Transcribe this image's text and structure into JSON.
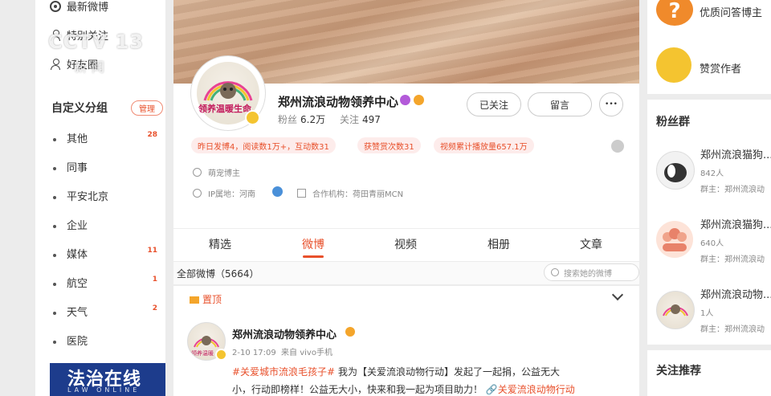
{
  "left_nav": {
    "items": [
      {
        "label": "最新微博"
      },
      {
        "label": "特别关注"
      },
      {
        "label": "好友圈"
      }
    ],
    "custom_group": {
      "title": "自定义分组",
      "manage_label": "管理"
    },
    "groups": [
      {
        "label": "其他",
        "count": "28"
      },
      {
        "label": "同事",
        "count": ""
      },
      {
        "label": "平安北京",
        "count": ""
      },
      {
        "label": "企业",
        "count": ""
      },
      {
        "label": "媒体",
        "count": "11"
      },
      {
        "label": "航空",
        "count": "1"
      },
      {
        "label": "天气",
        "count": "2"
      },
      {
        "label": "医院",
        "count": ""
      }
    ]
  },
  "watermark": {
    "tv_logo": "法治在线",
    "tv_logo_sub": "LAW ONLINE",
    "cctv": "CCTV 13",
    "cctv_sub": "新闻"
  },
  "profile": {
    "avatar_text": "领养温暖生命",
    "name": "郑州流浪动物领养中心",
    "fans_label": "粉丝",
    "fans_value": "6.2万",
    "follow_label": "关注",
    "follow_value": "497",
    "followed_button": "已关注",
    "message_button": "留言",
    "more_button": "•••",
    "pills": [
      "昨日发博4，阅读数1万+，互动数31",
      "获赞赏次数31",
      "视频累计播放量657.1万"
    ],
    "tag": "萌宠博主",
    "ip_location": "IP属地：河南",
    "agency": "合作机构：荷田青丽MCN"
  },
  "tabs": {
    "items": [
      {
        "label": "精选"
      },
      {
        "label": "微博"
      },
      {
        "label": "视频"
      },
      {
        "label": "相册"
      },
      {
        "label": "文章"
      }
    ],
    "active_index": 1
  },
  "feed": {
    "all_label": "全部微博（5664）",
    "search_placeholder": "搜索她的微博",
    "pinned_label": "置顶",
    "post": {
      "author": "郑州流浪动物领养中心",
      "time_source": "2-10 17:09  来自 vivo手机",
      "text_line1_tag": "#关爱城市流浪毛孩子#",
      "text_line1_rest": " 我为【关爱流浪动物行动】发起了一起捐，公益无大",
      "text_line2": "小，行动即榜样！公益无大小，快来和我一起为项目助力！",
      "text_line2_link": "关爱流浪动物行动"
    }
  },
  "right": {
    "top_items": [
      {
        "label": "优质问答博主"
      },
      {
        "label": "赞赏作者"
      }
    ],
    "fan_group_title": "粉丝群",
    "fan_groups": [
      {
        "name": "郑州流浪猫狗...",
        "count": "842人",
        "owner": "群主：郑州流浪动"
      },
      {
        "name": "郑州流浪猫狗...",
        "count": "640人",
        "owner": "群主：郑州流浪动"
      },
      {
        "name": "郑州流浪动物...",
        "count": "1人",
        "owner": "群主：郑州流浪动"
      }
    ],
    "recommend_title": "关注推荐"
  },
  "colors": {
    "accent": "#e8502b",
    "pill_bg": "#fdeceb",
    "gold": "#f4c430",
    "tv_blue": "#1d3c8c"
  }
}
